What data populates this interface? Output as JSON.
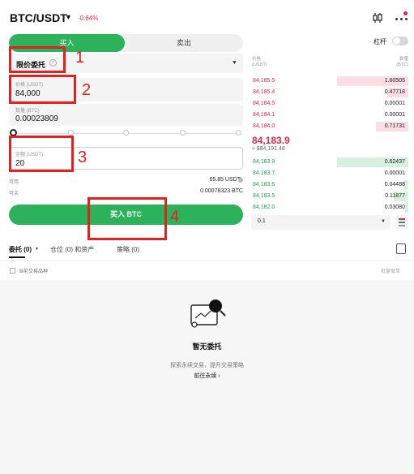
{
  "header": {
    "pair": "BTC/USDT",
    "change": "-0.64%",
    "colors": {
      "up": "#22a14e",
      "down": "#e0294a"
    }
  },
  "trade_tabs": {
    "buy": "买入",
    "sell": "卖出"
  },
  "leverage": {
    "label": "杠杆"
  },
  "order_form": {
    "order_type": "限价委托",
    "price_label": "价格 (USDT)",
    "price_value": "84,000",
    "quantity_label": "数量 (BTC)",
    "quantity_value": "0.00023809",
    "amount_label": "金额 (USDT)",
    "amount_value": "20",
    "available_label": "可用",
    "available_value": "65.85 USDT",
    "can_buy_label": "可买",
    "can_buy_value": "0.00078323 BTC",
    "submit_label": "买入 BTC",
    "accent": "#2cb25a"
  },
  "order_book": {
    "price_header": "价格",
    "price_unit": "(USDT)",
    "qty_header": "数量",
    "qty_unit": "(BTC)",
    "asks": [
      {
        "price": "84,185.5",
        "qty": "1.60505",
        "depth": 1.0
      },
      {
        "price": "84,185.4",
        "qty": "0.47718",
        "depth": 0.3
      },
      {
        "price": "84,184.5",
        "qty": "0.00001",
        "depth": 0.0
      },
      {
        "price": "84,184.1",
        "qty": "0.00001",
        "depth": 0.0
      },
      {
        "price": "84,184.0",
        "qty": "0.71731",
        "depth": 0.45
      }
    ],
    "last_price": "84,183.9",
    "last_price_fiat": "≈ $84,191.48",
    "bids": [
      {
        "price": "84,183.9",
        "qty": "0.62437",
        "depth": 1.0
      },
      {
        "price": "84,183.7",
        "qty": "0.00001",
        "depth": 0.0
      },
      {
        "price": "84,183.6",
        "qty": "0.04488",
        "depth": 0.07
      },
      {
        "price": "84,183.5",
        "qty": "0.11877",
        "depth": 0.2
      },
      {
        "price": "84,182.0",
        "qty": "0.03080",
        "depth": 0.05
      }
    ],
    "precision": "0.1"
  },
  "bottom_tabs": [
    {
      "label": "委托 (0)"
    },
    {
      "label": "仓位 (0) 和资产"
    },
    {
      "label": "策略 (0)"
    }
  ],
  "filter": {
    "current_only": "当前交易品种",
    "batch_cancel": "批量撤单"
  },
  "empty_state": {
    "title": "暂无委托",
    "description": "探索永续交易，提升交易策略",
    "link": "前往永续 ›"
  },
  "annotations": [
    "1",
    "2",
    "3",
    "4"
  ]
}
